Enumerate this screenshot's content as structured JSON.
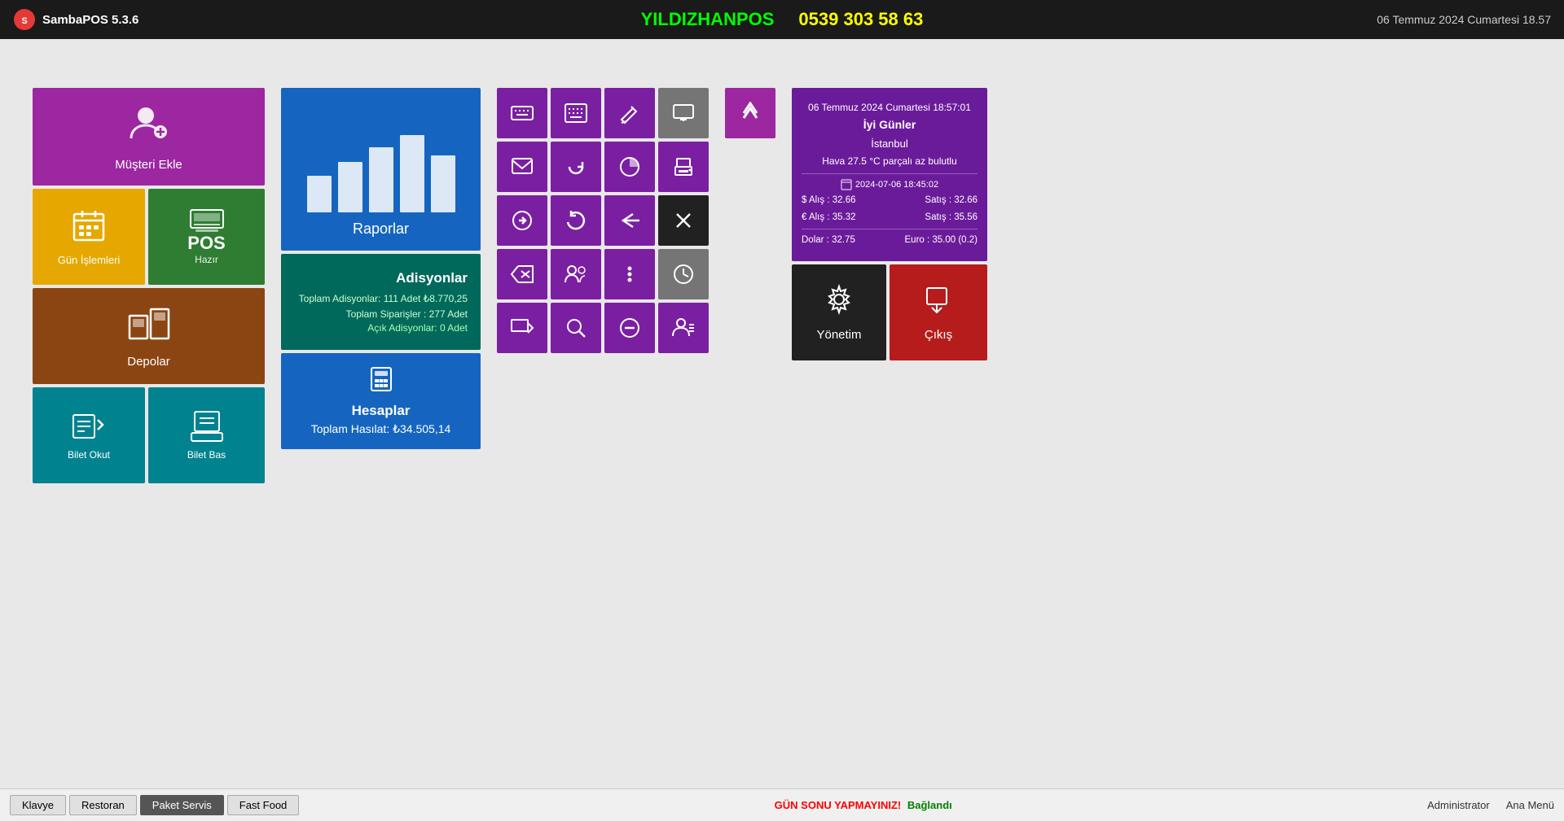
{
  "header": {
    "logo": "SambaPOS 5.3.6",
    "brand": "YILDIZHANPOS",
    "phone": "0539 303 58 63",
    "datetime": "06 Temmuz 2024 Cumartesi 18.57"
  },
  "tiles": {
    "musteri_ekle": "Müşteri Ekle",
    "gun_islemleri": "Gün İşlemleri",
    "pos_label": "POS",
    "pos_status": "Hazır",
    "depolar": "Depolar",
    "bilet_okut": "Bilet Okut",
    "bilet_bas": "Bilet Bas",
    "raporlar": "Raporlar",
    "adisyonlar_title": "Adisyonlar",
    "adisyonlar_line1": "Toplam Adisyonlar: 111 Adet  ₺8.770,25",
    "adisyonlar_line2": "Toplam Siparişler : 277 Adet",
    "adisyonlar_line3": "Açık Adisyonlar: 0 Adet",
    "hesaplar_title": "Hesaplar",
    "hesaplar_amount": "Toplam Hasılat:    ₺34.505,14",
    "yonetim": "Yönetim",
    "cikis": "Çıkış"
  },
  "info_panel": {
    "datetime": "06 Temmuz 2024 Cumartesi 18:57:01",
    "greeting": "İyi Günler",
    "city": "İstanbul",
    "weather": "Hava 27.5 °C  parçalı az bulutlu",
    "exchange_date": "2024-07-06 18:45:02",
    "usd_buy": "$ Alış : 32.66",
    "usd_sell": "Satış : 32.66",
    "eur_buy": "€ Alış : 35.32",
    "eur_sell": "Satış : 35.56",
    "dolar": "Dolar : 32.75",
    "euro": "Euro : 35.00  (0.2)"
  },
  "bottom": {
    "tab1": "Klavye",
    "tab2": "Restoran",
    "tab3": "Paket Servis",
    "tab4": "Fast Food",
    "notice_warning": "GÜN SONU YAPMAYINIZ!",
    "notice_status": "Bağlandı",
    "user": "Administrator",
    "menu": "Ana Menü"
  },
  "chart_bars": [
    40,
    55,
    70,
    90,
    65
  ]
}
